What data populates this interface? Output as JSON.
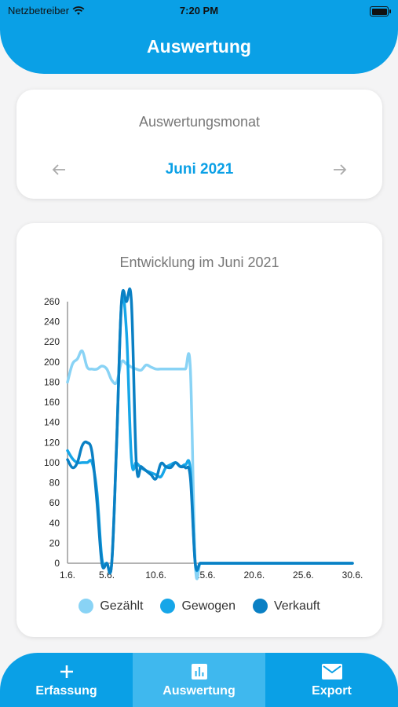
{
  "status_bar": {
    "carrier": "Netzbetreiber",
    "time": "7:20 PM"
  },
  "header": {
    "title": "Auswertung"
  },
  "month_selector": {
    "label": "Auswertungsmonat",
    "value": "Juni 2021"
  },
  "chart_card": {
    "title": "Entwicklung im Juni 2021"
  },
  "chart_data": {
    "type": "line",
    "title": "Entwicklung im Juni 2021",
    "xlabel": "",
    "ylabel": "",
    "x": [
      1,
      1.5,
      2,
      2.5,
      3,
      3.5,
      4,
      4.5,
      5,
      5.5,
      6,
      6.5,
      7,
      7.5,
      8,
      8.5,
      9,
      9.5,
      10,
      10.5,
      11,
      11.5,
      12,
      12.5,
      13,
      13.5,
      14,
      14.5,
      15,
      15.5,
      16,
      30
    ],
    "x_ticks": [
      1,
      5,
      10,
      15,
      20,
      25,
      30
    ],
    "x_tick_labels": [
      "1.6.",
      "5.6.",
      "10.6.",
      "15.6.",
      "20.6.",
      "25.6.",
      "30.6."
    ],
    "ylim": [
      0,
      260
    ],
    "y_ticks": [
      0,
      20,
      40,
      60,
      80,
      100,
      120,
      140,
      160,
      180,
      200,
      220,
      240,
      260
    ],
    "grid": false,
    "legend_position": "bottom",
    "series": [
      {
        "name": "Gezählt",
        "color": "#89d3f5",
        "values": [
          180,
          198,
          203,
          211,
          195,
          193,
          193,
          196,
          193,
          182,
          180,
          200,
          198,
          195,
          193,
          192,
          197,
          195,
          193,
          193,
          193,
          193,
          193,
          193,
          193,
          193,
          0,
          0,
          0,
          0,
          0,
          0
        ]
      },
      {
        "name": "Gewogen",
        "color": "#16a6e8",
        "values": [
          112,
          104,
          100,
          100,
          100,
          100,
          70,
          5,
          0,
          0,
          120,
          258,
          230,
          104,
          100,
          95,
          92,
          90,
          88,
          86,
          95,
          98,
          100,
          96,
          98,
          93,
          0,
          0,
          0,
          0,
          0,
          0
        ]
      },
      {
        "name": "Verkauft",
        "color": "#0a80c4",
        "values": [
          103,
          95,
          100,
          117,
          120,
          110,
          60,
          0,
          0,
          0,
          120,
          260,
          260,
          260,
          100,
          96,
          92,
          88,
          84,
          99,
          96,
          95,
          100,
          96,
          95,
          85,
          0,
          0,
          0,
          0,
          0,
          0
        ]
      }
    ]
  },
  "legend": {
    "items": [
      "Gezählt",
      "Gewogen",
      "Verkauft"
    ]
  },
  "bottom_nav": {
    "items": [
      {
        "label": "Erfassung",
        "icon": "plus-icon"
      },
      {
        "label": "Auswertung",
        "icon": "bar-chart-icon",
        "active": true
      },
      {
        "label": "Export",
        "icon": "mail-icon"
      }
    ]
  },
  "colors": {
    "primary": "#0aa0e6",
    "nav_active": "#3fb8ee"
  }
}
